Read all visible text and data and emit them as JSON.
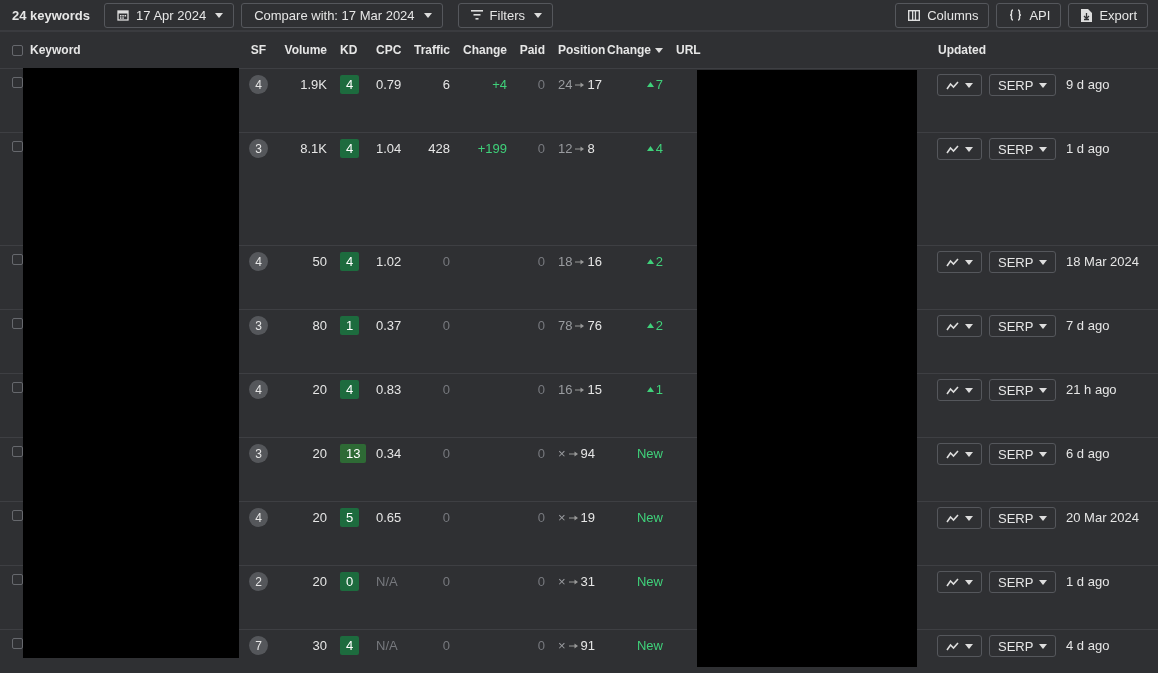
{
  "toolbar": {
    "count": "24 keywords",
    "date": "17 Apr 2024",
    "compare": "Compare with: 17 Mar 2024",
    "filters": "Filters",
    "columns": "Columns",
    "api": "API",
    "export": "Export"
  },
  "table": {
    "select_all": {
      "checked": false
    },
    "columns": [
      {
        "label": "Keyword",
        "sorted": false
      },
      {
        "label": "SF",
        "sorted": false
      },
      {
        "label": "Volume",
        "sorted": false
      },
      {
        "label": "KD",
        "sorted": false
      },
      {
        "label": "CPC",
        "sorted": false
      },
      {
        "label": "Traffic",
        "sorted": false
      },
      {
        "label": "Change",
        "sorted": false
      },
      {
        "label": "Paid",
        "sorted": false
      },
      {
        "label": "Position",
        "sorted": false
      },
      {
        "label": "Change",
        "sorted": true
      },
      {
        "label": "URL",
        "sorted": false
      },
      {
        "label": "Updated",
        "sorted": false
      }
    ],
    "rows": [
      {
        "checked": false,
        "expanded": false,
        "sf": "4",
        "volume": "1.9K",
        "kd": {
          "value": "4",
          "color": "#1d6b3e"
        },
        "cpc": "0.79",
        "cpc_dim": false,
        "traffic": "6",
        "traffic_dim": false,
        "traffic_change": "+4",
        "paid": "0",
        "pos_from": "24",
        "pos_to": "17",
        "position_change": {
          "kind": "up",
          "text": "7"
        },
        "serp": "SERP",
        "updated": "9 d ago"
      },
      {
        "checked": false,
        "expanded": true,
        "sf": "3",
        "volume": "8.1K",
        "kd": {
          "value": "4",
          "color": "#1d6b3e"
        },
        "cpc": "1.04",
        "cpc_dim": false,
        "traffic": "428",
        "traffic_dim": false,
        "traffic_change": "+199",
        "paid": "0",
        "pos_from": "12",
        "pos_to": "8",
        "position_change": {
          "kind": "up",
          "text": "4"
        },
        "serp": "SERP",
        "updated": "1 d ago"
      },
      {
        "checked": false,
        "expanded": false,
        "sf": "4",
        "volume": "50",
        "kd": {
          "value": "4",
          "color": "#1d6b3e"
        },
        "cpc": "1.02",
        "cpc_dim": false,
        "traffic": "0",
        "traffic_dim": true,
        "paid": "0",
        "pos_from": "18",
        "pos_to": "16",
        "position_change": {
          "kind": "up",
          "text": "2"
        },
        "serp": "SERP",
        "updated": "18 Mar 2024"
      },
      {
        "checked": false,
        "expanded": false,
        "sf": "3",
        "volume": "80",
        "kd": {
          "value": "1",
          "color": "#1d6b3e"
        },
        "cpc": "0.37",
        "cpc_dim": false,
        "traffic": "0",
        "traffic_dim": true,
        "paid": "0",
        "pos_from": "78",
        "pos_to": "76",
        "position_change": {
          "kind": "up",
          "text": "2"
        },
        "serp": "SERP",
        "updated": "7 d ago"
      },
      {
        "checked": false,
        "expanded": false,
        "sf": "4",
        "volume": "20",
        "kd": {
          "value": "4",
          "color": "#1d6b3e"
        },
        "cpc": "0.83",
        "cpc_dim": false,
        "traffic": "0",
        "traffic_dim": true,
        "paid": "0",
        "pos_from": "16",
        "pos_to": "15",
        "position_change": {
          "kind": "up",
          "text": "1"
        },
        "serp": "SERP",
        "updated": "21 h ago"
      },
      {
        "checked": false,
        "expanded": false,
        "sf": "3",
        "volume": "20",
        "kd": {
          "value": "13",
          "color": "#2e6a35"
        },
        "cpc": "0.34",
        "cpc_dim": false,
        "traffic": "0",
        "traffic_dim": true,
        "paid": "0",
        "pos_from": "×",
        "pos_to": "94",
        "position_change": {
          "kind": "new",
          "text": "New"
        },
        "serp": "SERP",
        "updated": "6 d ago"
      },
      {
        "checked": false,
        "expanded": false,
        "sf": "4",
        "volume": "20",
        "kd": {
          "value": "5",
          "color": "#1d6b3e"
        },
        "cpc": "0.65",
        "cpc_dim": false,
        "traffic": "0",
        "traffic_dim": true,
        "paid": "0",
        "pos_from": "×",
        "pos_to": "19",
        "position_change": {
          "kind": "new",
          "text": "New"
        },
        "serp": "SERP",
        "updated": "20 Mar 2024"
      },
      {
        "checked": false,
        "expanded": false,
        "sf": "2",
        "volume": "20",
        "kd": {
          "value": "0",
          "color": "#1d6b3e"
        },
        "cpc": "N/A",
        "cpc_dim": true,
        "traffic": "0",
        "traffic_dim": true,
        "paid": "0",
        "pos_from": "×",
        "pos_to": "31",
        "position_change": {
          "kind": "new",
          "text": "New"
        },
        "serp": "SERP",
        "updated": "1 d ago"
      },
      {
        "checked": false,
        "expanded": false,
        "sf": "7",
        "volume": "30",
        "kd": {
          "value": "4",
          "color": "#1d6b3e"
        },
        "cpc": "N/A",
        "cpc_dim": true,
        "traffic": "0",
        "traffic_dim": true,
        "paid": "0",
        "pos_from": "×",
        "pos_to": "91",
        "position_change": {
          "kind": "new",
          "text": "New"
        },
        "serp": "SERP",
        "updated": "4 d ago"
      }
    ]
  }
}
